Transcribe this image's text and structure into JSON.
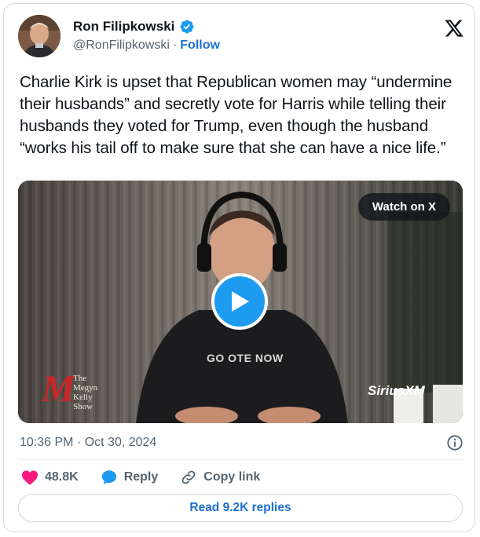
{
  "author": {
    "name": "Ron Filipkowski",
    "handle": "@RonFilipkowski",
    "separator": "·",
    "follow_label": "Follow",
    "verified": true,
    "avatar_icon": "avatar-photo"
  },
  "tweet": {
    "text": "Charlie Kirk is upset that Republican women may “undermine their husbands” and secretly vote for Harris while telling their husbands they voted for Trump, even though the husband “works his tail off to make sure that she can have a nice life.”",
    "timestamp": "10:36 PM · Oct 30, 2024"
  },
  "media": {
    "watch_label": "Watch on X",
    "play_icon": "play-icon",
    "shirt_text": "GO  OTE NOW",
    "watermark_right": "SiriusXM",
    "watermark_left": {
      "mark": "M",
      "lines": [
        "The",
        "Megyn",
        "Kelly",
        "Show"
      ]
    }
  },
  "actions": {
    "like_count": "48.8K",
    "reply_label": "Reply",
    "copy_label": "Copy link"
  },
  "footer": {
    "read_replies_label": "Read 9.2K replies"
  },
  "colors": {
    "accent": "#1d9bf0",
    "link": "#1d6fd1",
    "like": "#f91880",
    "muted": "#536471"
  }
}
